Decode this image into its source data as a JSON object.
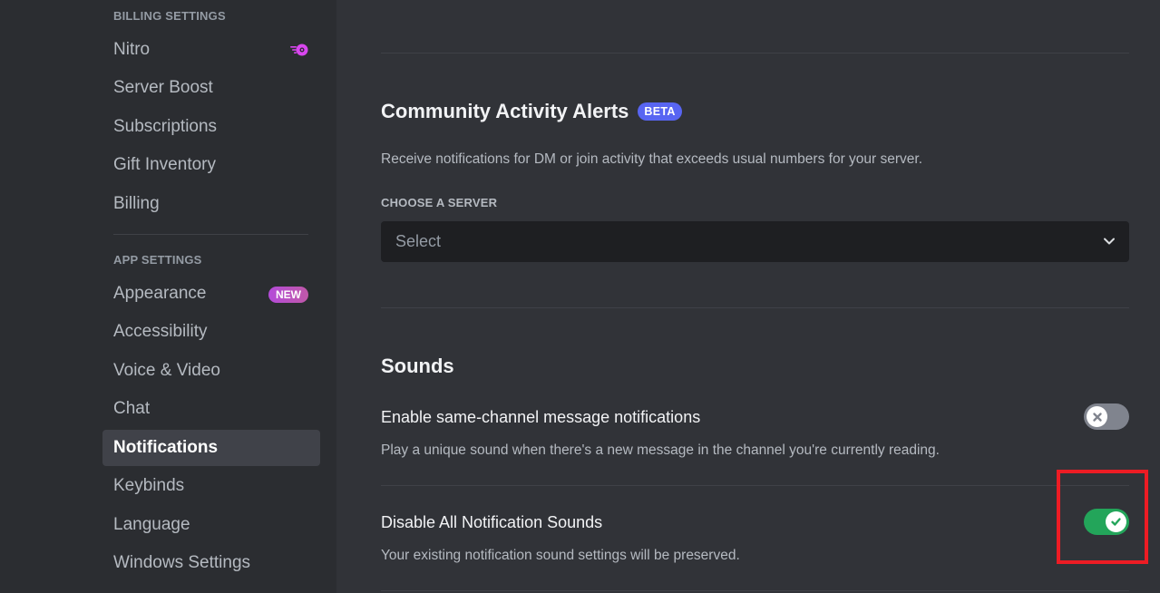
{
  "sidebar": {
    "billing_header": "Billing Settings",
    "billing_items": [
      {
        "label": "Nitro",
        "icon": "nitro-icon"
      },
      {
        "label": "Server Boost"
      },
      {
        "label": "Subscriptions"
      },
      {
        "label": "Gift Inventory"
      },
      {
        "label": "Billing"
      }
    ],
    "app_header": "App Settings",
    "app_items": [
      {
        "label": "Appearance",
        "badge": "NEW"
      },
      {
        "label": "Accessibility"
      },
      {
        "label": "Voice & Video"
      },
      {
        "label": "Chat"
      },
      {
        "label": "Notifications",
        "selected": true
      },
      {
        "label": "Keybinds"
      },
      {
        "label": "Language"
      },
      {
        "label": "Windows Settings"
      }
    ]
  },
  "community_alerts": {
    "title": "Community Activity Alerts",
    "badge": "BETA",
    "description": "Receive notifications for DM or join activity that exceeds usual numbers for your server.",
    "server_label": "Choose a Server",
    "select_placeholder": "Select"
  },
  "sounds": {
    "title": "Sounds",
    "settings": [
      {
        "title": "Enable same-channel message notifications",
        "description": "Play a unique sound when there's a new message in the channel you're currently reading.",
        "enabled": false
      },
      {
        "title": "Disable All Notification Sounds",
        "description": "Your existing notification sound settings will be preserved.",
        "enabled": true
      }
    ]
  },
  "colors": {
    "accent": "#5865f2",
    "toggle_on": "#23a55a",
    "toggle_off": "#80848e",
    "highlight": "#ed1c24",
    "nitro": "#d946ef"
  }
}
